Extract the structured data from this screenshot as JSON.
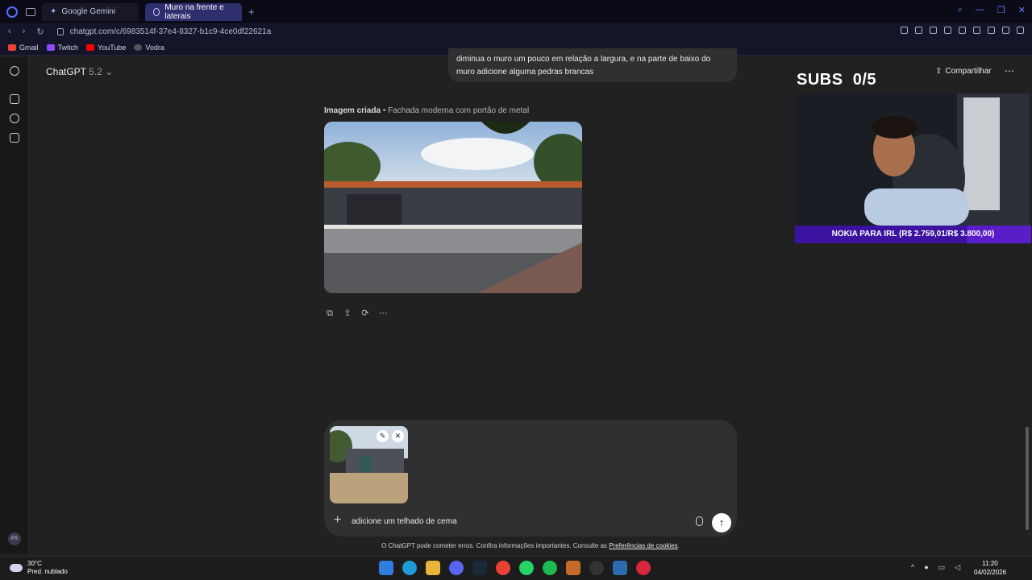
{
  "browser": {
    "tabs": [
      {
        "label": "Google Gemini",
        "active": false
      },
      {
        "label": "Muro na frente e laterais",
        "active": true
      }
    ],
    "url": "chatgpt.com/c/6983514f-37e4-8327-b1c9-4ce0df22621a",
    "bookmarks": [
      "Gmail",
      "Twitch",
      "YouTube",
      "Vodra"
    ]
  },
  "sidebar": {
    "avatar_initials": "PS"
  },
  "header": {
    "model_name": "ChatGPT",
    "model_version": "5.2",
    "share_label": "Compartilhar"
  },
  "chat": {
    "user_message": "diminua o muro um pouco em relação a largura, e na parte de baixo do muro adicione alguma pedras brancas",
    "image_caption_bold": "Imagem criada",
    "image_caption_rest": " • Fachada moderna com portão de metal"
  },
  "composer": {
    "input_value": "adicione um telhado de cema"
  },
  "disclaimer": {
    "text": "O ChatGPT pode cometer erros. Confira informações importantes. Consulte as ",
    "link": "Preferências de cookies",
    "end": "."
  },
  "stream_overlay": {
    "subs_label": "SUBS",
    "subs_count": "0/5",
    "goal_text": "NOKIA PARA IRL (R$ 2.759,01/R$ 3.800,00)",
    "goal_progress": 0.726
  },
  "taskbar": {
    "temp": "30°C",
    "weather": "Pred. nublado",
    "time": "11:20",
    "date": "04/02/2026"
  },
  "colors": {
    "accent": "#5a1ec9",
    "background": "#212121",
    "composer": "#303030"
  }
}
